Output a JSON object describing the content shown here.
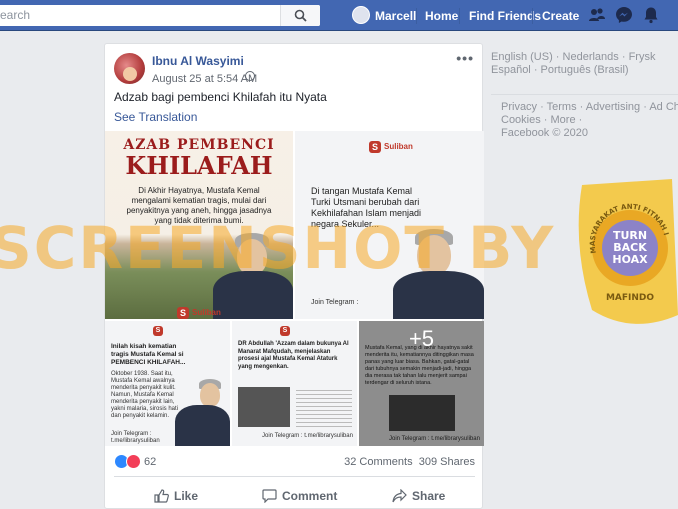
{
  "topbar": {
    "search_placeholder": "earch",
    "user_name": "Marcell",
    "home": "Home",
    "find_friends": "Find Friends",
    "create": "Create"
  },
  "post": {
    "author": "Ibnu Al Wasyimi",
    "time": "August 25 at 5:54 AM",
    "text": "Adzab bagi pembenci Khilafah itu Nyata",
    "see_translation": "See Translation",
    "more": "•••",
    "photos": {
      "p1_title1": "AZAB PEMBENCI",
      "p1_title2": "KHILAFAH",
      "p1_body": "Di Akhir Hayatnya, Mustafa Kemal mengalami kematian tragis, mulai dari penyakitnya yang aneh, hingga jasadnya yang tidak diterima bumi.",
      "p1_logo": "Suliban",
      "p2_logo": "Suliban",
      "p2_body": "Di tangan Mustafa Kemal Turki Utsmani berubah dari Kekhilafahan Islam menjadi negara Sekuler...",
      "p2_join": "Join Telegram :",
      "p3_body": "Inilah kisah kematian tragis Mustafa Kemal si PEMBENCI KHILAFAH...",
      "p3_small": "Oktober 1938. Saat itu, Mustafa Kemal awalnya menderita penyakit kulit. Namun, Mustafa Kemal menderita penyakit lain, yakni malaria, sirosis hati dan penyakit kelamin.",
      "p3_join": "Join Telegram : t.me/librarysuliban",
      "p4_body": "DR Abdullah 'Azzam dalam bukunya Al Manarat Mafqudah, menjelaskan prosesi ajal Mustafa Kemal Ataturk yang mengenkan.",
      "p4_join": "Join Telegram : t.me/librarysuliban",
      "p5_more": "+5",
      "p5_body": "Mustafa Kemal, yang di akhir hayatnya sakit menderita itu, kematiannya ditinggikan masa panas yang luar biasa. Bahkan, gatal-gatal dari tubuhnya semakin menjadi-jadi, hingga dia merasa tak tahan lalu menjerit sampai terdengar di seluruh istana.",
      "p5_join": "Join Telegram : t.me/librarysuliban"
    },
    "reactions_count": "62",
    "comments": "32 Comments",
    "shares": "309 Shares",
    "like": "Like",
    "comment": "Comment",
    "share": "Share"
  },
  "sidebar": {
    "lang_current": "English (US)",
    "lang_sep": " · ",
    "lang_nl": "Nederlands",
    "lang_fy": "Frysk",
    "lang_es": "Español",
    "lang_pt": "Português (Brasil)",
    "footer_line1": "Privacy · Terms · Advertising · Ad Choices",
    "footer_line2": "Cookies · More ·",
    "footer_line3": "Facebook © 2020"
  },
  "watermark": {
    "text": "SCREENSHOT BY",
    "badge_ring": "MASYARAKAT ANTI FITNAH INDONESIA",
    "badge_center1": "TURN",
    "badge_center2": "BACK",
    "badge_center3": "HOAX",
    "badge_bottom": "MAFINDO"
  },
  "colors": {
    "topbar": "#4267b2",
    "link": "#385898",
    "like_reaction": "#2d88ff",
    "love_reaction": "#f33e58",
    "watermark": "#f5aa28",
    "badge": "#f4c430"
  }
}
